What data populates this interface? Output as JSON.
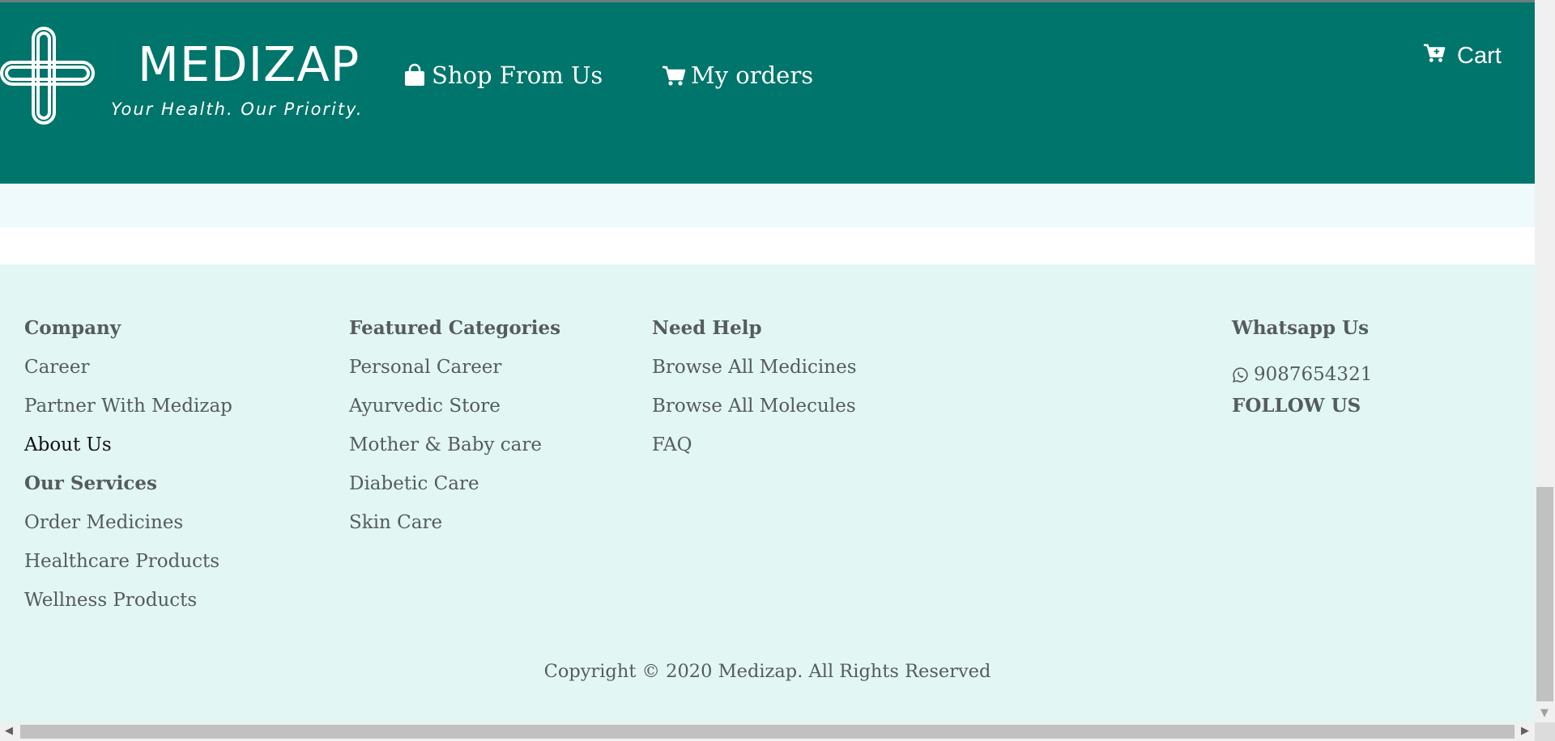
{
  "header": {
    "brand_name": "MEDIZAP",
    "tagline": "Your Health. Our Priority.",
    "nav": [
      {
        "label": "Shop From Us",
        "icon": "shopping-bag-icon"
      },
      {
        "label": "My orders",
        "icon": "cart-icon"
      }
    ],
    "cart_label": "Cart",
    "cart_icon": "cart-plus-icon",
    "background_color": "#00756b"
  },
  "footer": {
    "company": {
      "heading": "Company",
      "links": [
        "Career",
        "Partner With Medizap",
        "About Us"
      ],
      "services_heading": "Our Services",
      "services": [
        "Order Medicines",
        "Healthcare Products",
        "Wellness Products"
      ]
    },
    "featured": {
      "heading": "Featured Categories",
      "links": [
        "Personal Career",
        "Ayurvedic Store",
        "Mother & Baby care",
        "Diabetic Care",
        "Skin Care"
      ]
    },
    "help": {
      "heading": "Need Help",
      "links": [
        "Browse All Medicines",
        "Browse All Molecules",
        "FAQ"
      ]
    },
    "whatsapp": {
      "heading": "Whatsapp Us",
      "phone": "9087654321",
      "icon": "whatsapp-icon",
      "follow_label": "FOLLOW US"
    },
    "copyright": "Copyright © 2020 Medizap. All Rights Reserved",
    "background_color": "#e2f6f4"
  }
}
